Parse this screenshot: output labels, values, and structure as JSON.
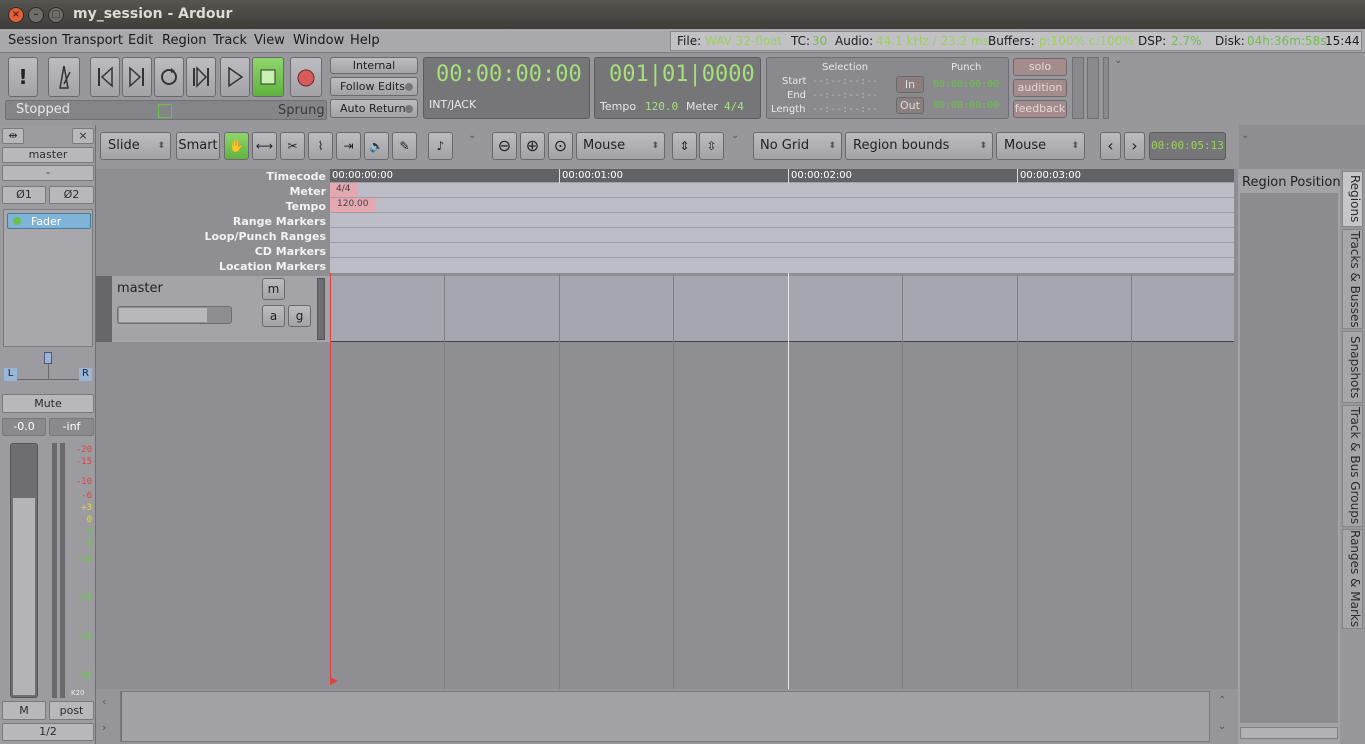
{
  "window": {
    "title": "my_session - Ardour",
    "close": "×",
    "min": "–",
    "max": "□"
  },
  "menu": [
    "Session",
    "Transport",
    "Edit",
    "Region",
    "Track",
    "View",
    "Window",
    "Help"
  ],
  "status": {
    "file_label": "File:",
    "file_value": "WAV 32-float",
    "tc_label": "TC:",
    "tc_value": "30",
    "audio_label": "Audio:",
    "audio_value": "44.1 kHz / 23.2 ms",
    "buffers_label": "Buffers:",
    "buffers_value": "p:100% c:100%",
    "dsp_label": "DSP:",
    "dsp_value": "2.7%",
    "disk_label": "Disk:",
    "disk_value": "04h:36m:58s",
    "time": "15:44"
  },
  "transport": {
    "alert": "!",
    "stopped": "Stopped",
    "sprung": "Sprung",
    "internal": "Internal",
    "follow_edits": "Follow Edits",
    "auto_return": "Auto Return"
  },
  "clock1": {
    "time": "00:00:00:00",
    "source": "INT/JACK"
  },
  "clock2": {
    "bbt": "001|01|0000",
    "tempo_label": "Tempo",
    "tempo_value": "120.0",
    "meter_label": "Meter",
    "meter_value": "4/4"
  },
  "selection": {
    "title": "Selection",
    "start": "Start",
    "end": "End",
    "length": "Length",
    "empty": "--:--:--:--"
  },
  "punch": {
    "title": "Punch",
    "in": "In",
    "out": "Out",
    "in_time": "00:00:00:00",
    "out_time": "00:00:00:00"
  },
  "monitor": {
    "solo": "solo",
    "audition": "audition",
    "feedback": "feedback"
  },
  "edit_toolbar": {
    "edit_mode": "Slide",
    "smart": "Smart",
    "zoom_focus": "Mouse",
    "grid": "No Grid",
    "snap": "Region bounds",
    "edit_point": "Mouse",
    "nudge": "00:00:05:13"
  },
  "rulers": {
    "timecode": "Timecode",
    "meter": "Meter",
    "tempo": "Tempo",
    "range": "Range Markers",
    "loop": "Loop/Punch Ranges",
    "cd": "CD Markers",
    "location": "Location Markers"
  },
  "timecode_ticks": [
    "00:00:00:00",
    "00:00:01:00",
    "00:00:02:00",
    "00:00:03:00"
  ],
  "meter_marker": "4/4",
  "tempo_marker": "120.00",
  "track": {
    "name": "master",
    "m": "m",
    "a": "a",
    "g": "g"
  },
  "strip": {
    "name": "master",
    "dash": "-",
    "phase1": "Ø1",
    "phase2": "Ø2",
    "fader": "Fader",
    "pan_l": "L",
    "pan_r": "R",
    "mute": "Mute",
    "gain": "-0.0",
    "peak": "-inf",
    "meter_type": "K20",
    "m": "M",
    "post": "post",
    "page": "1/2"
  },
  "meter_scale": [
    "-20",
    "-15",
    "-10",
    "-6",
    "+3",
    "0",
    "-3",
    "-6",
    "-10",
    "-20",
    "-30",
    "-40"
  ],
  "regions": {
    "col1": "Region",
    "col2": "Position"
  },
  "side_tabs": [
    "Regions",
    "Tracks & Busses",
    "Snapshots",
    "Track & Bus Groups",
    "Ranges & Marks"
  ],
  "colors": {
    "green": "#6cc04a",
    "play_green": "#6fc24f",
    "record": "#d95a5a",
    "playhead": "#e04040"
  }
}
